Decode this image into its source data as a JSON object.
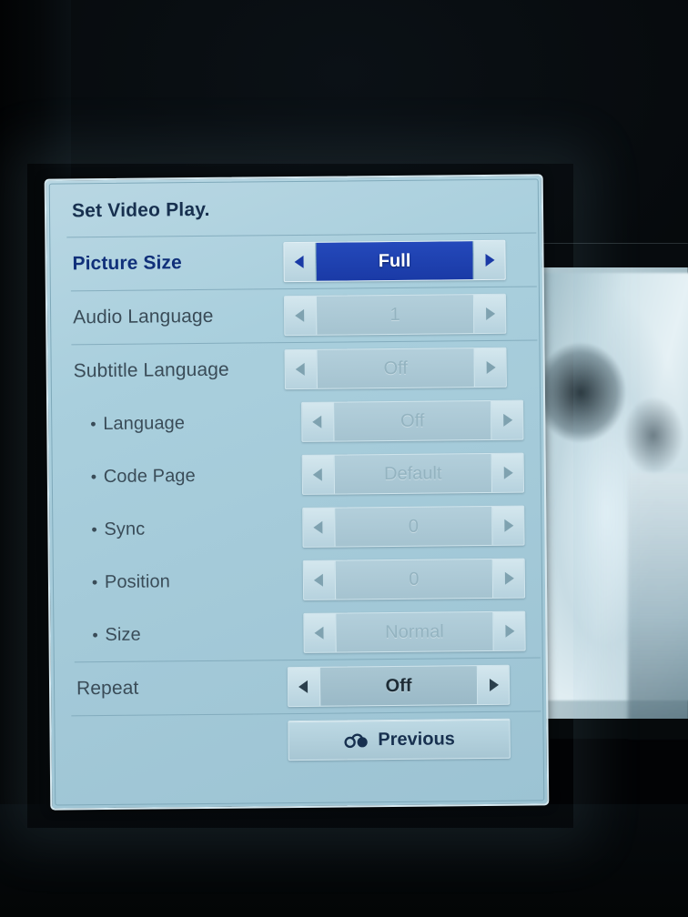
{
  "device": {
    "screen_type": "tv-osd",
    "accent_blue": "#1a3aa6",
    "panel_bg": "#a9cfdd",
    "label_color": "#3a4c58",
    "disabled_value_color": "#93b3c0"
  },
  "dialog": {
    "title": "Set Video Play.",
    "rows": [
      {
        "id": "picture-size",
        "label": "Picture Size",
        "value": "Full",
        "state": "selected",
        "sub": false,
        "left_arrow": "left-arrow-icon",
        "right_arrow": "right-arrow-icon"
      },
      {
        "id": "audio-language",
        "label": "Audio Language",
        "value": "1",
        "state": "disabled",
        "sub": false,
        "left_arrow": "left-arrow-icon",
        "right_arrow": "right-arrow-icon"
      },
      {
        "id": "subtitle-language",
        "label": "Subtitle Language",
        "value": "Off",
        "state": "disabled",
        "sub": false,
        "left_arrow": "left-arrow-icon",
        "right_arrow": "right-arrow-icon"
      },
      {
        "id": "language",
        "label": "Language",
        "bullet": "•",
        "value": "Off",
        "state": "disabled",
        "sub": true,
        "left_arrow": "left-arrow-icon",
        "right_arrow": "right-arrow-icon"
      },
      {
        "id": "code-page",
        "label": "Code Page",
        "bullet": "•",
        "value": "Default",
        "state": "disabled",
        "sub": true,
        "left_arrow": "left-arrow-icon",
        "right_arrow": "right-arrow-icon"
      },
      {
        "id": "sync",
        "label": "Sync",
        "bullet": "•",
        "value": "0",
        "state": "disabled",
        "sub": true,
        "left_arrow": "left-arrow-icon",
        "right_arrow": "right-arrow-icon"
      },
      {
        "id": "position",
        "label": "Position",
        "bullet": "•",
        "value": "0",
        "state": "disabled",
        "sub": true,
        "left_arrow": "left-arrow-icon",
        "right_arrow": "right-arrow-icon"
      },
      {
        "id": "size",
        "label": "Size",
        "bullet": "•",
        "value": "Normal",
        "state": "disabled",
        "sub": true,
        "left_arrow": "left-arrow-icon",
        "right_arrow": "right-arrow-icon"
      },
      {
        "id": "repeat",
        "label": "Repeat",
        "value": "Off",
        "state": "enabled",
        "sub": false,
        "left_arrow": "left-arrow-icon",
        "right_arrow": "right-arrow-icon"
      }
    ],
    "footer": {
      "previous_label": "Previous",
      "previous_icon": "back-return-icon"
    }
  }
}
